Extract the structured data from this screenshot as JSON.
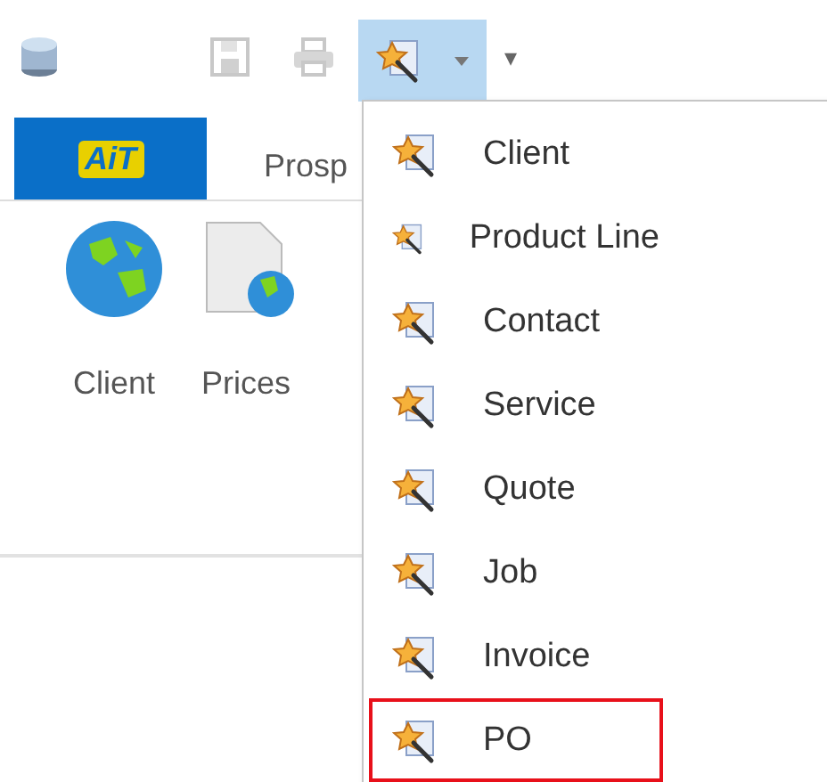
{
  "toolbar": {
    "wizard_button": {
      "selected": true
    },
    "overflow_glyph": "▾"
  },
  "tabs": [
    {
      "kind": "logo",
      "label": "AiT",
      "selected": true
    },
    {
      "kind": "text",
      "label": "Prosp",
      "selected": false
    }
  ],
  "ribbon": {
    "buttons": [
      {
        "kind": "globe",
        "label": "Client"
      },
      {
        "kind": "document",
        "label": "Prices"
      }
    ]
  },
  "menu": {
    "items": [
      {
        "label": "Client",
        "highlighted": false
      },
      {
        "label": "Product Line",
        "highlighted": false
      },
      {
        "label": "Contact",
        "highlighted": false
      },
      {
        "label": "Service",
        "highlighted": false
      },
      {
        "label": "Quote",
        "highlighted": false
      },
      {
        "label": "Job",
        "highlighted": false
      },
      {
        "label": "Invoice",
        "highlighted": false
      },
      {
        "label": "PO",
        "highlighted": true
      }
    ]
  }
}
